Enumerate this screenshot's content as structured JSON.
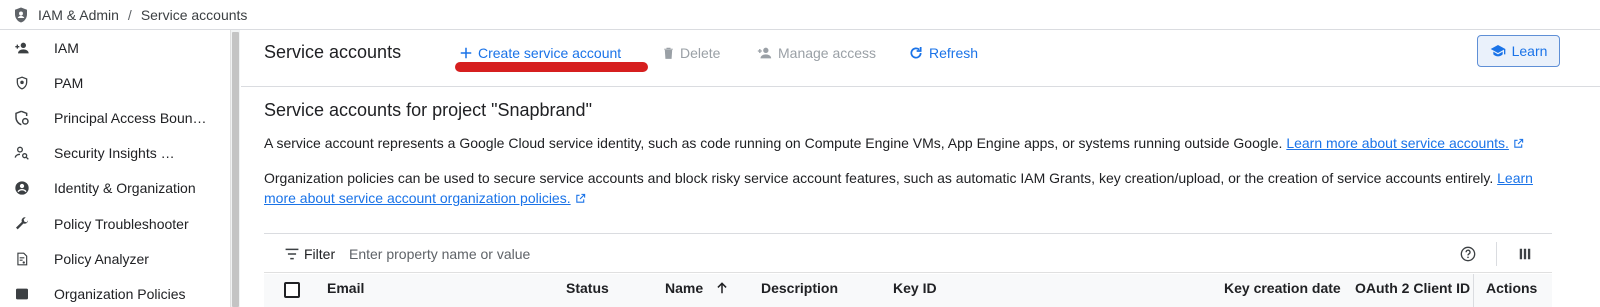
{
  "breadcrumb": {
    "section": "IAM & Admin",
    "separator": "/",
    "page": "Service accounts"
  },
  "sidebar": {
    "items": [
      {
        "label": "IAM",
        "icon": "person-add-icon"
      },
      {
        "label": "PAM",
        "icon": "shield-icon"
      },
      {
        "label": "Principal Access Boun…",
        "icon": "shield-gear-icon"
      },
      {
        "label": "Security Insights …",
        "icon": "person-search-icon"
      },
      {
        "label": "Identity & Organization",
        "icon": "account-circle-icon"
      },
      {
        "label": "Policy Troubleshooter",
        "icon": "wrench-icon"
      },
      {
        "label": "Policy Analyzer",
        "icon": "document-search-icon"
      },
      {
        "label": "Organization Policies",
        "icon": "list-icon"
      }
    ]
  },
  "toolbar": {
    "title": "Service accounts",
    "create_label": "Create service account",
    "delete_label": "Delete",
    "manage_label": "Manage access",
    "refresh_label": "Refresh",
    "learn_label": "Learn"
  },
  "content": {
    "heading": "Service accounts for project \"Snapbrand\"",
    "para1_text": "A service account represents a Google Cloud service identity, such as code running on Compute Engine VMs, App Engine apps, or systems running outside Google. ",
    "para1_link": "Learn more about service accounts.",
    "para2_text": "Organization policies can be used to secure service accounts and block risky service account features, such as automatic IAM Grants, key creation/upload, or the creation of service accounts entirely. ",
    "para2_link": "Learn more about service account organization policies."
  },
  "filter": {
    "label": "Filter",
    "placeholder": "Enter property name or value"
  },
  "table": {
    "columns": [
      "Email",
      "Status",
      "Name",
      "Description",
      "Key ID",
      "Key creation date",
      "OAuth 2 Client ID",
      "Actions"
    ],
    "sort_column": "Name",
    "sort_direction": "ascending"
  },
  "colors": {
    "accent": "#1a73e8",
    "disabled": "#9aa0a6",
    "annotation": "#d61f1f"
  }
}
